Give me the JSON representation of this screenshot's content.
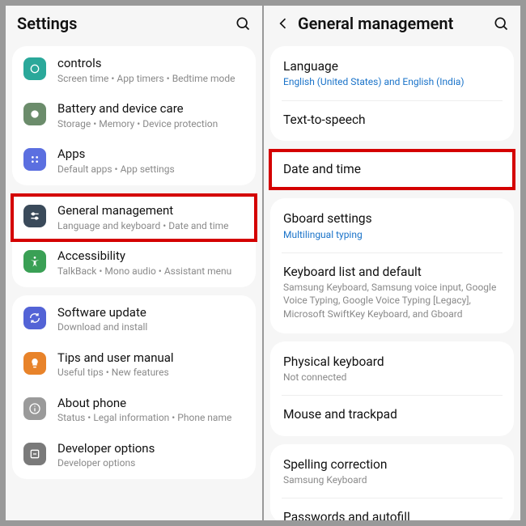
{
  "left": {
    "title": "Settings",
    "cards": [
      {
        "items": [
          {
            "icon": "circle-icon",
            "bg": "bg-teal",
            "label": "controls",
            "sub": "Screen time  •  App timers  •  Bedtime mode"
          },
          {
            "icon": "battery-icon",
            "bg": "bg-sage",
            "label": "Battery and device care",
            "sub": "Storage  •  Memory  •  Device protection"
          },
          {
            "icon": "apps-icon",
            "bg": "bg-blue2",
            "label": "Apps",
            "sub": "Default apps  •  App settings"
          }
        ]
      },
      {
        "items": [
          {
            "icon": "sliders-icon",
            "bg": "bg-slate",
            "label": "General management",
            "sub": "Language and keyboard  •  Date and time",
            "hl": true
          },
          {
            "icon": "accessibility-icon",
            "bg": "bg-green2",
            "label": "Accessibility",
            "sub": "TalkBack  •  Mono audio  •  Assistant menu"
          }
        ]
      },
      {
        "items": [
          {
            "icon": "update-icon",
            "bg": "bg-indigo",
            "label": "Software update",
            "sub": "Download and install"
          },
          {
            "icon": "tips-icon",
            "bg": "bg-orange",
            "label": "Tips and user manual",
            "sub": "Useful tips  •  New features"
          },
          {
            "icon": "info-icon",
            "bg": "bg-gray",
            "label": "About phone",
            "sub": "Status  •  Legal information  •  Phone name"
          },
          {
            "icon": "dev-icon",
            "bg": "bg-gray2",
            "label": "Developer options",
            "sub": "Developer options"
          }
        ]
      }
    ]
  },
  "right": {
    "title": "General management",
    "cards": [
      {
        "items": [
          {
            "label": "Language",
            "sub": "English (United States) and English (India)",
            "link": true
          },
          {
            "label": "Text-to-speech"
          }
        ]
      },
      {
        "items": [
          {
            "label": "Date and time",
            "hl": true
          }
        ]
      },
      {
        "items": [
          {
            "label": "Gboard settings",
            "sub": "Multilingual typing",
            "link": true
          },
          {
            "label": "Keyboard list and default",
            "sub": "Samsung Keyboard, Samsung voice input, Google Voice Typing, Google Voice Typing [Legacy], Microsoft SwiftKey Keyboard, and Gboard"
          }
        ]
      },
      {
        "items": [
          {
            "label": "Physical keyboard",
            "sub": "Not connected"
          },
          {
            "label": "Mouse and trackpad"
          }
        ]
      },
      {
        "items": [
          {
            "label": "Spelling correction",
            "sub": "Samsung Keyboard"
          },
          {
            "label": "Passwords and autofill",
            "cutoff": true
          }
        ]
      }
    ]
  }
}
